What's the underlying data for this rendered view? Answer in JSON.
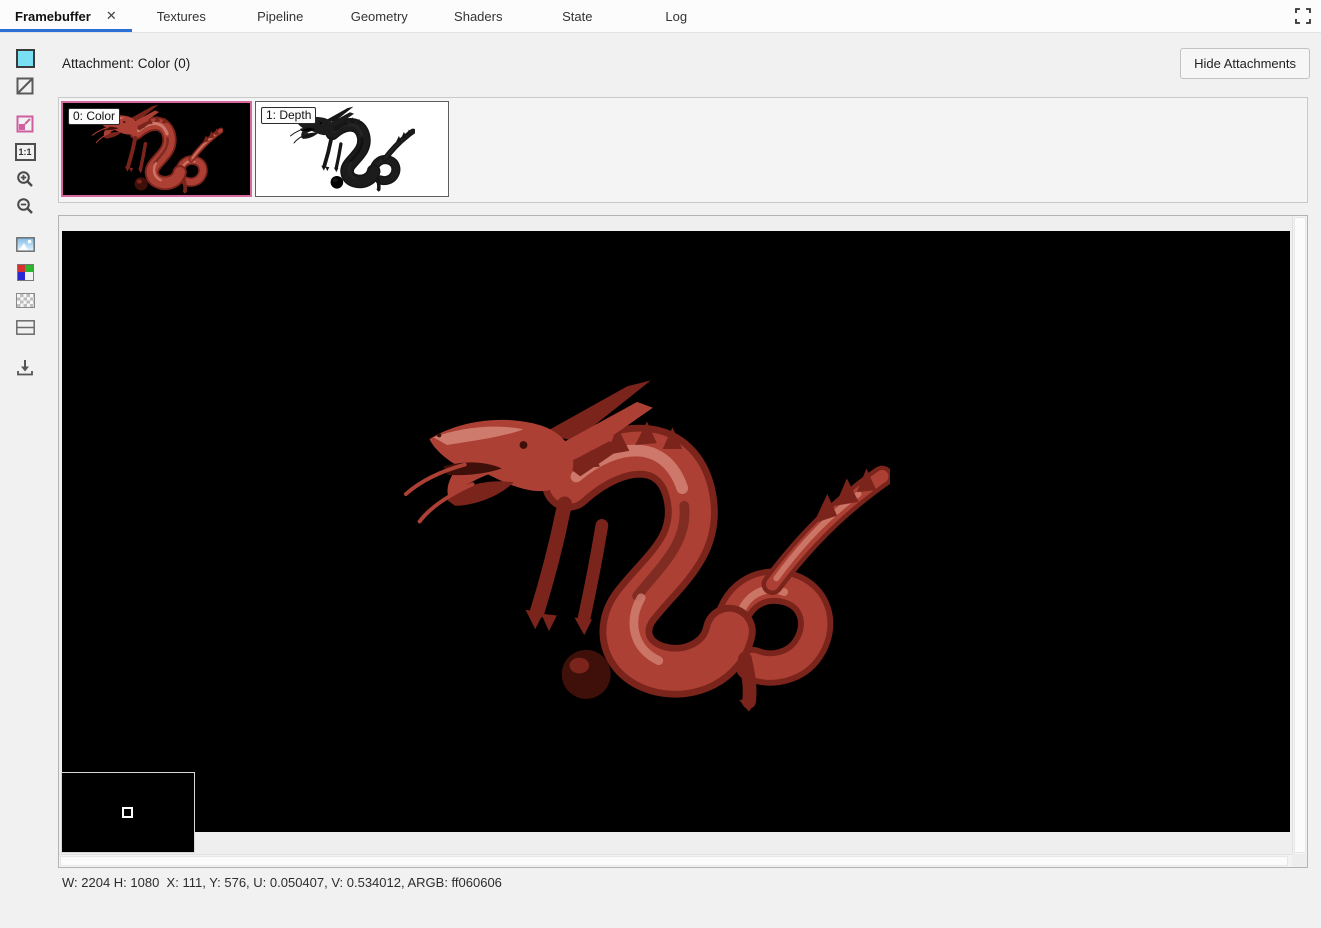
{
  "tab_bar": {
    "close_icon": "✕",
    "tabs": [
      {
        "label": "Framebuffer",
        "active": true
      },
      {
        "label": "Textures",
        "active": false
      },
      {
        "label": "Pipeline",
        "active": false
      },
      {
        "label": "Geometry",
        "active": false
      },
      {
        "label": "Shaders",
        "active": false
      },
      {
        "label": "State",
        "active": false
      },
      {
        "label": "Log",
        "active": false
      }
    ]
  },
  "toolbar": {
    "zoom_actual_label": "1:1",
    "icons": [
      "color-attachment-icon",
      "wireframe-overlay-icon",
      "zoom-to-fit-icon",
      "zoom-actual-size-icon",
      "zoom-in-icon",
      "zoom-out-icon",
      "image-background-icon",
      "color-channels-icon",
      "checkerboard-background-icon",
      "flip-vertical-icon",
      "save-image-icon"
    ]
  },
  "attachment_header": {
    "label": "Attachment: Color (0)",
    "hide_button_label": "Hide Attachments"
  },
  "attachments": [
    {
      "label": "0: Color",
      "selected": true
    },
    {
      "label": "1: Depth",
      "selected": false
    }
  ],
  "status_bar": {
    "text": "W: 2204 H: 1080  X: 111, Y: 576, U: 0.050407, V: 0.534012, ARGB: ff060606"
  },
  "colors": {
    "active_tab_underline": "#2b6fd7",
    "selected_attachment_border": "#d9679f",
    "viewport_background": "#000000",
    "render_base_red": "#ad4034"
  }
}
